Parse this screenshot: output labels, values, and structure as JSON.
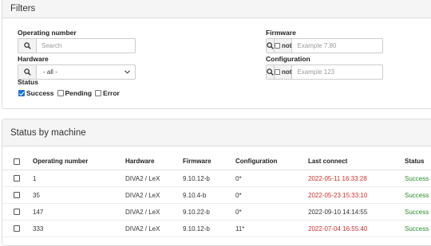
{
  "filters": {
    "title": "Filters",
    "operating_number": {
      "label": "Operating number",
      "placeholder": "Search"
    },
    "hardware": {
      "label": "Hardware",
      "selected": "- all -"
    },
    "firmware": {
      "label": "Firmware",
      "not_label": "not",
      "placeholder": "Example 7.80"
    },
    "configuration": {
      "label": "Configuration",
      "not_label": "not",
      "placeholder": "Example 123"
    },
    "status": {
      "label": "Status",
      "options": [
        {
          "label": "Success",
          "checked": true
        },
        {
          "label": "Pending",
          "checked": false
        },
        {
          "label": "Error",
          "checked": false
        }
      ]
    }
  },
  "status_by_machine": {
    "title": "Status by machine",
    "columns": [
      "Operating number",
      "Hardware",
      "Firmware",
      "Configuration",
      "Last connect",
      "Status"
    ],
    "rows": [
      {
        "op": "1",
        "hw": "DIVA2 / LeX",
        "fw": "9.10.12-b",
        "cfg": "0*",
        "last": "2022-05-11 16:33:28",
        "last_color": "#c9302c",
        "status": "Success"
      },
      {
        "op": "35",
        "hw": "DIVA2 / LeX",
        "fw": "9.10.4-b",
        "cfg": "0*",
        "last": "2022-05-23 15:33:10",
        "last_color": "#c9302c",
        "status": "Success"
      },
      {
        "op": "147",
        "hw": "DIVA2 / LeX",
        "fw": "9.10.22-b",
        "cfg": "0*",
        "last": "2022-09-10 14:14:55",
        "last_color": "#333333",
        "status": "Success"
      },
      {
        "op": "333",
        "hw": "DIVA2 / LeX",
        "fw": "9.10.12-b",
        "cfg": "11*",
        "last": "2022-07-04 16:55:40",
        "last_color": "#c9302c",
        "status": "Success"
      }
    ]
  },
  "icons": {
    "search": "search-icon",
    "dropdown": "chevron-down-icon"
  },
  "colors": {
    "success": "#2a8a2a",
    "overdue": "#c9302c",
    "checkbox_checked": "#1e73d8"
  }
}
